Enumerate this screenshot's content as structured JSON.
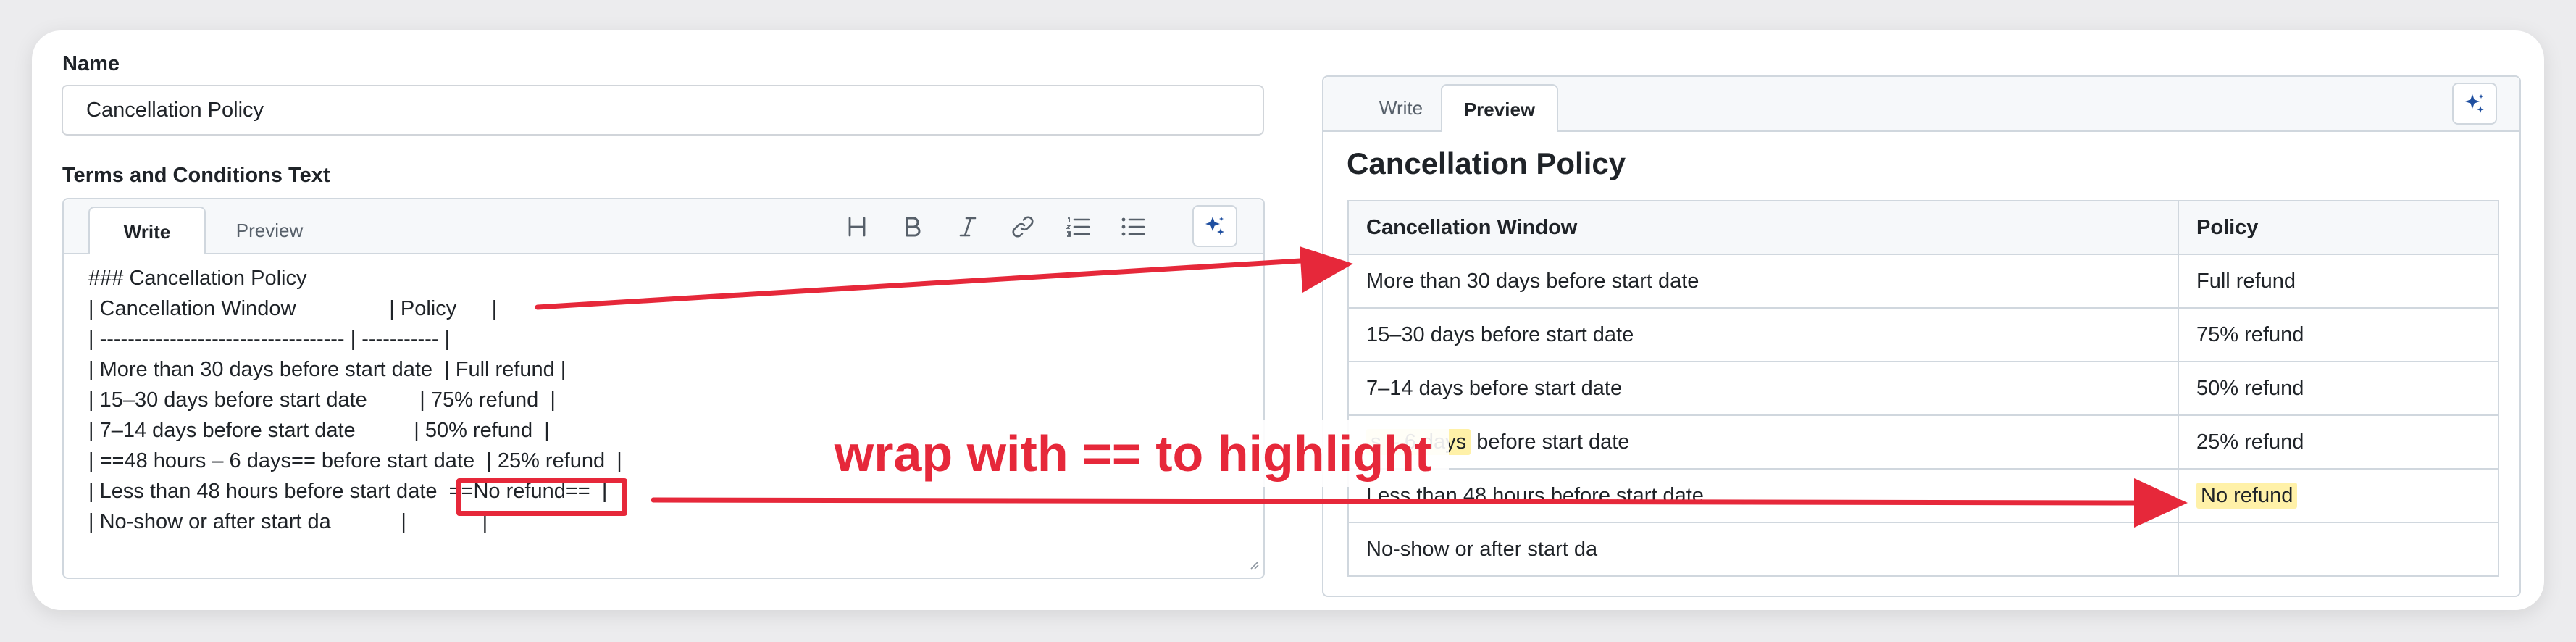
{
  "form": {
    "name_label": "Name",
    "name_value": "Cancellation Policy",
    "terms_label": "Terms and Conditions Text"
  },
  "editor": {
    "tab_write": "Write",
    "tab_preview": "Preview",
    "active_tab": "Write",
    "toolbar": [
      "heading-icon",
      "bold-icon",
      "italic-icon",
      "link-icon",
      "ordered-list-icon",
      "bullet-list-icon",
      "sparkle-icon"
    ],
    "lines": [
      "### Cancellation Policy",
      "| Cancellation Window                | Policy      |",
      "| ----------------------------------- | ----------- |",
      "| More than 30 days before start date  | Full refund |",
      "| 15–30 days before start date         | 75% refund  |",
      "| 7–14 days before start date          | 50% refund  |",
      "| ==48 hours – 6 days== before start date  | 25% refund  |",
      "| Less than 48 hours before start date  ==No refund==  |",
      "| No-show or after start da            |             |"
    ]
  },
  "preview": {
    "tab_write": "Write",
    "tab_preview": "Preview",
    "active_tab": "Preview",
    "title": "Cancellation Policy",
    "headers": [
      "Cancellation Window",
      "Policy"
    ],
    "rows": [
      [
        "More than 30 days before start date",
        "Full refund"
      ],
      [
        "15–30 days before start date",
        "75% refund"
      ],
      [
        "7–14 days before start date",
        "50% refund"
      ],
      [
        "s – 6 days",
        " before start date",
        "25% refund"
      ],
      [
        "Less than 48 hours before start date",
        "No refund"
      ],
      [
        "No-show or after start da",
        ""
      ]
    ]
  },
  "annotation": {
    "callout": "wrap with == to highlight",
    "color": "#e6283a"
  }
}
